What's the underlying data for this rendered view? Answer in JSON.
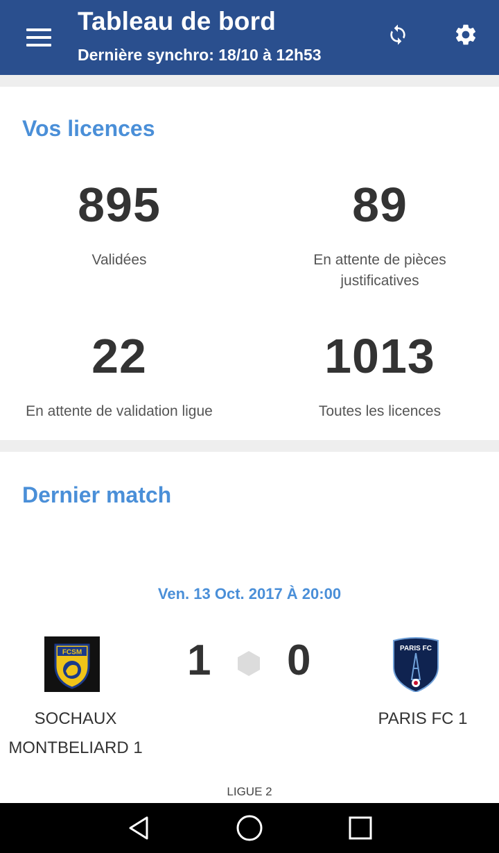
{
  "header": {
    "title": "Tableau de bord",
    "subtitle": "Dernière synchro: 18/10 à 12h53",
    "menu_icon": "hamburger-menu-icon",
    "sync_icon": "sync-icon",
    "settings_icon": "gear-icon",
    "background": "#2a4f8e"
  },
  "licences": {
    "title": "Vos licences",
    "stats": [
      {
        "value": "895",
        "label": "Validées"
      },
      {
        "value": "89",
        "label": "En attente de pièces justificatives"
      },
      {
        "value": "22",
        "label": "En attente de validation ligue"
      },
      {
        "value": "1013",
        "label": "Toutes les licences"
      }
    ]
  },
  "match": {
    "title": "Dernier match",
    "date": "Ven. 13 Oct. 2017 À 20:00",
    "home": {
      "name_line1": "SOCHAUX",
      "name_line2": "MONTBELIARD 1",
      "score": "1",
      "logo_text": "FCSM"
    },
    "away": {
      "name_line1": "PARIS FC 1",
      "score": "0",
      "logo_text": "PARIS FC"
    },
    "league": "LIGUE 2"
  },
  "colors": {
    "accent": "#4a8fd8",
    "text": "#333333"
  }
}
